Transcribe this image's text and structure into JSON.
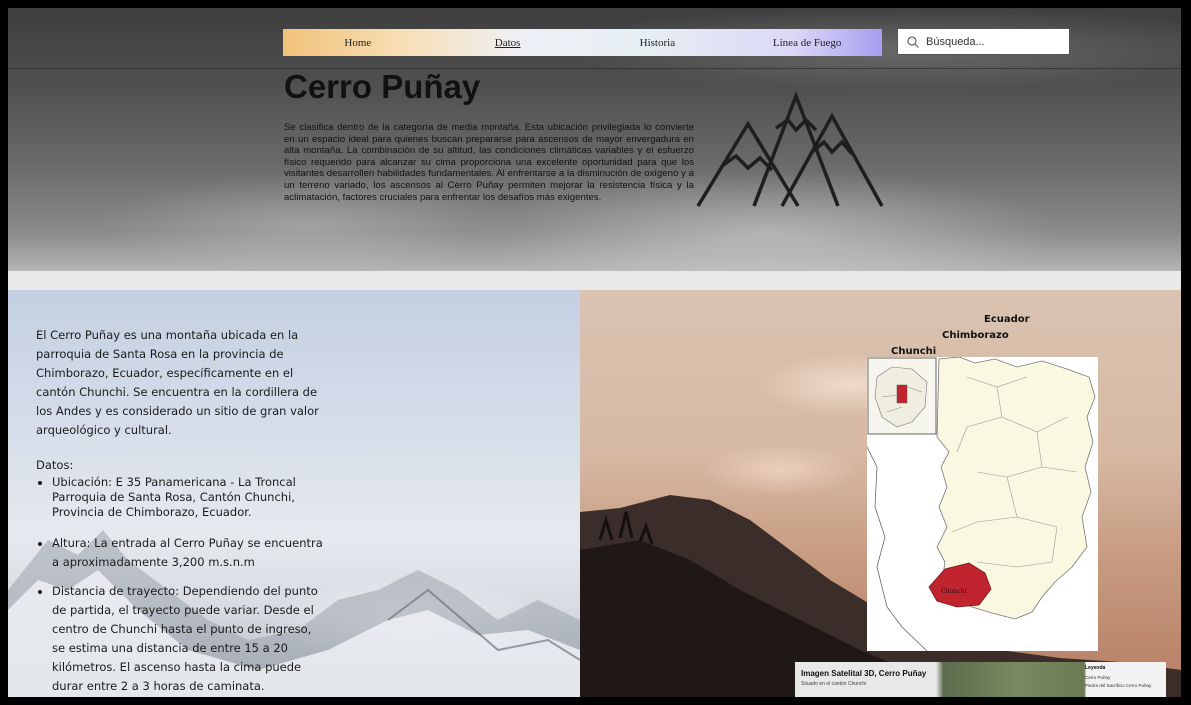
{
  "nav": {
    "items": [
      {
        "label": "Home"
      },
      {
        "label": "Datos"
      },
      {
        "label": "Historia"
      },
      {
        "label": "Linea de Fuego"
      }
    ]
  },
  "search": {
    "placeholder": "Búsqueda..."
  },
  "hero": {
    "title": "Cerro Puñay",
    "description": "Se clasifica dentro de la categoría de media montaña. Esta ubicación privilegiada lo convierte en un espacio ideal para quienes buscan prepararse para ascensos de mayor envergadura en alta montaña. La combinación de su altitud, las condiciones climáticas variables y el esfuerzo físico requerido para alcanzar su cima proporciona una excelente oportunidad para que los visitantes desarrollen habilidades fundamentales. Al enfrentarse a la disminución de oxígeno y a un terreno variado, los ascensos al Cerro Puñay permiten mejorar la resistencia física y la aclimatación, factores cruciales para enfrentar los desafíos más exigentes."
  },
  "info": {
    "intro": "El Cerro Puñay es una montaña ubicada en la parroquia de Santa Rosa en la provincia de Chimborazo, Ecuador, específicamente en el cantón Chunchi. Se encuentra en la cordillera de los Andes y es considerado un sitio de gran valor arqueológico y cultural.",
    "datos_label": "Datos:",
    "bullets": [
      "Ubicación: E 35 Panamericana - La Troncal Parroquia de Santa Rosa, Cantón Chunchi, Provincia de Chimborazo, Ecuador.",
      "Altura: La entrada al Cerro Puñay se encuentra a aproximadamente 3,200 m.s.n.m",
      "Distancia de trayecto: Dependiendo del punto de partida, el trayecto puede variar. Desde el centro de Chunchi hasta el punto de ingreso, se estima una distancia de entre 15 a 20 kilómetros. El ascenso hasta la cima puede durar entre 2 a 3 horas de caminata."
    ]
  },
  "map": {
    "label_country": "Ecuador",
    "label_province": "Chimborazo",
    "label_canton": "Chunchi",
    "highlight_label": "Chunchi",
    "highlight_color": "#c0242f"
  },
  "satellite": {
    "title": "Imagen Satelital 3D, Cerro Puñay",
    "subtitle": "Situado en el cantón Chunchi",
    "legend_title": "Leyenda",
    "legend_items": [
      "Cerro Puñay",
      "Piedra del Sacrificio Cerro Puñay"
    ]
  }
}
